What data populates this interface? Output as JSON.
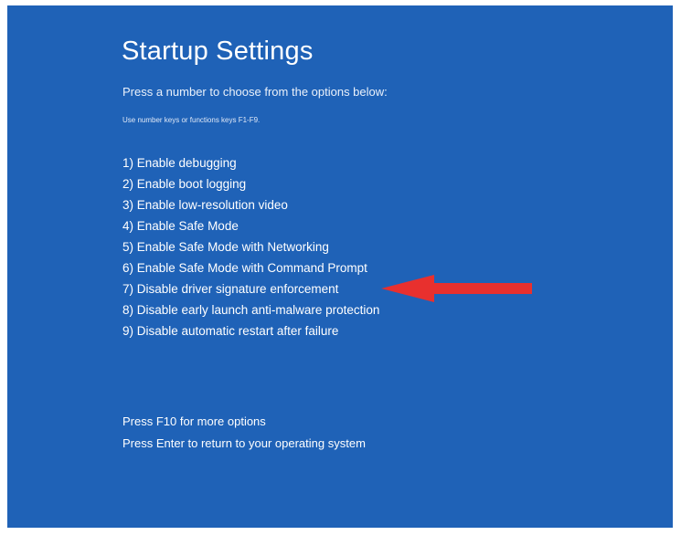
{
  "screen": {
    "title": "Startup Settings",
    "subtitle": "Press a number to choose from the options below:",
    "hint": "Use number keys or functions keys F1-F9.",
    "options": [
      "1) Enable debugging",
      "2) Enable boot logging",
      "3) Enable low-resolution video",
      "4) Enable Safe Mode",
      "5) Enable Safe Mode with Networking",
      "6) Enable Safe Mode with Command Prompt",
      "7) Disable driver signature enforcement",
      "8) Disable early launch anti-malware protection",
      "9) Disable automatic restart after failure"
    ],
    "footer": {
      "more_options": "Press F10 for more options",
      "return_os": "Press Enter to return to your operating system"
    }
  },
  "colors": {
    "background": "#1f62b7",
    "text": "#ffffff",
    "arrow": "#e8302e"
  },
  "annotation": {
    "icon": "red-arrow-icon",
    "points_to_option": 7
  }
}
